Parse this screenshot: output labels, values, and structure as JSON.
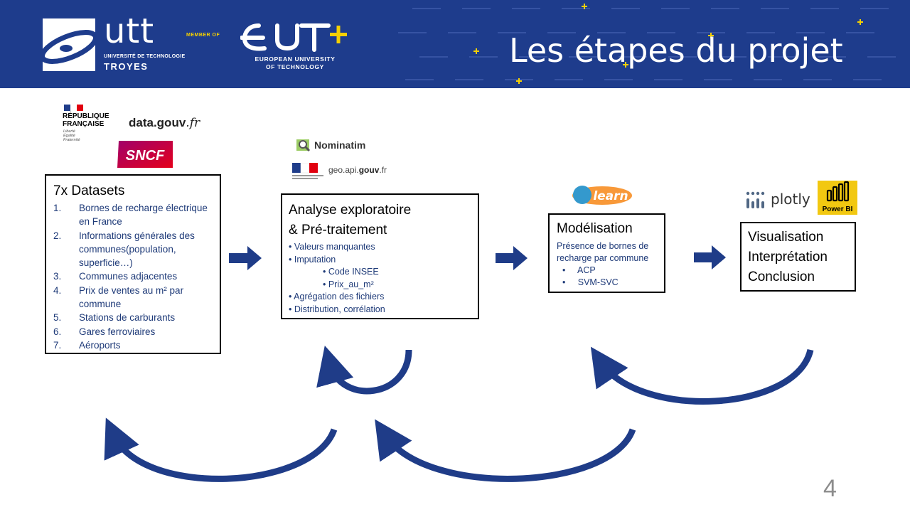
{
  "header": {
    "title": "Les étapes du projet",
    "utt": {
      "name": "utt",
      "subtitle": "UNIVERSITÉ DE TECHNOLOGIE",
      "city": "TROYES"
    },
    "member_of": "MEMBER OF",
    "eut": {
      "name_line1": "EUROPEAN UNIVERSITY",
      "name_line2": "OF TECHNOLOGY"
    }
  },
  "logos": {
    "rf_line1": "RÉPUBLIQUE",
    "rf_line2": "FRANÇAISE",
    "rf_motto": [
      "Liberté",
      "Égalité",
      "Fraternité"
    ],
    "datagouv": "data.gouv",
    "datagouv_tld": ".fr",
    "sncf": "SNCF",
    "nominatim": "Nominatim",
    "geo_prefix": "geo.api.",
    "geo_bold": "gouv",
    "geo_suffix": ".fr",
    "sklearn": "learn",
    "plotly": "plotly",
    "powerbi": "Power BI"
  },
  "datasets": {
    "title": "7x Datasets",
    "items": [
      "Bornes de recharge électrique en France",
      "Informations générales des communes(population, superficie…)",
      "Communes adjacentes",
      "Prix de ventes au m² par commune",
      "Stations de carburants",
      "Gares ferroviaires",
      "Aéroports"
    ]
  },
  "analysis": {
    "title_line1": "Analyse exploratoire",
    "title_line2": "& Pré-traitement",
    "items": [
      "• Valeurs manquantes",
      "• Imputation",
      "• Code INSEE",
      "• Prix_au_m²",
      "• Agrégation des fichiers",
      "• Distribution, corrélation"
    ]
  },
  "modeling": {
    "title": "Modélisation",
    "description": "Présence de bornes de recharge par commune",
    "items": [
      "•     ACP",
      "•     SVM-SVC"
    ]
  },
  "visualisation": {
    "lines": [
      "Visualisation",
      "Interprétation",
      "Conclusion"
    ]
  },
  "page_number": "4",
  "colors": {
    "header_bg": "#1e3c8c",
    "arrow": "#1f3c88",
    "accent_yellow": "#f5d000",
    "list_text": "#1e3a78"
  }
}
